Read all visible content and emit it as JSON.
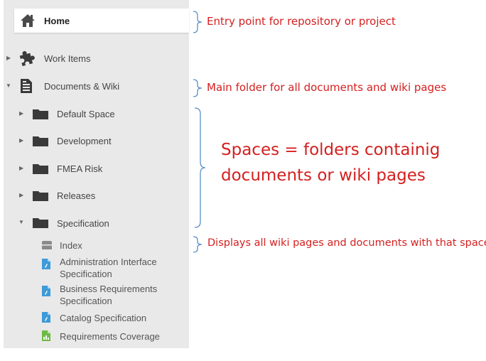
{
  "tree": {
    "home": {
      "label": "Home",
      "icon": "home-icon"
    },
    "work_items": {
      "label": "Work Items",
      "icon": "puzzle-icon",
      "expanded": false
    },
    "documents_wiki": {
      "label": "Documents & Wiki",
      "icon": "document-list-icon",
      "expanded": true
    },
    "spaces": [
      {
        "label": "Default Space",
        "icon": "folder-icon",
        "expanded": false
      },
      {
        "label": "Development",
        "icon": "folder-icon",
        "expanded": false
      },
      {
        "label": "FMEA Risk",
        "icon": "folder-icon",
        "expanded": false
      },
      {
        "label": "Releases",
        "icon": "folder-icon",
        "expanded": false
      },
      {
        "label": "Specification",
        "icon": "folder-icon",
        "expanded": true
      }
    ],
    "items": [
      {
        "label": "Index",
        "icon": "index-page-icon"
      },
      {
        "label": "Administration Interface Specification",
        "line1": "Administration Interface",
        "line2": "Specification",
        "icon": "document-icon"
      },
      {
        "label": "Business Requirements Specification",
        "line1": "Business Requirements",
        "line2": "Specification",
        "icon": "document-icon"
      },
      {
        "label": "Catalog Specification",
        "icon": "document-icon"
      },
      {
        "label": "Requirements Coverage",
        "icon": "report-icon"
      }
    ]
  },
  "annotations": {
    "home": "Entry point for repository or project",
    "documents": "Main folder for all documents and wiki pages",
    "spaces_line1": "Spaces = folders containig",
    "spaces_line2": "documents or wiki pages",
    "index": "Displays all wiki pages and documents with that space"
  },
  "colors": {
    "annotation": "#d42020",
    "brace": "#5b8fc7",
    "folder": "#3a3a3a",
    "document_blue": "#3e9ad8",
    "report_green": "#6dbb45"
  }
}
